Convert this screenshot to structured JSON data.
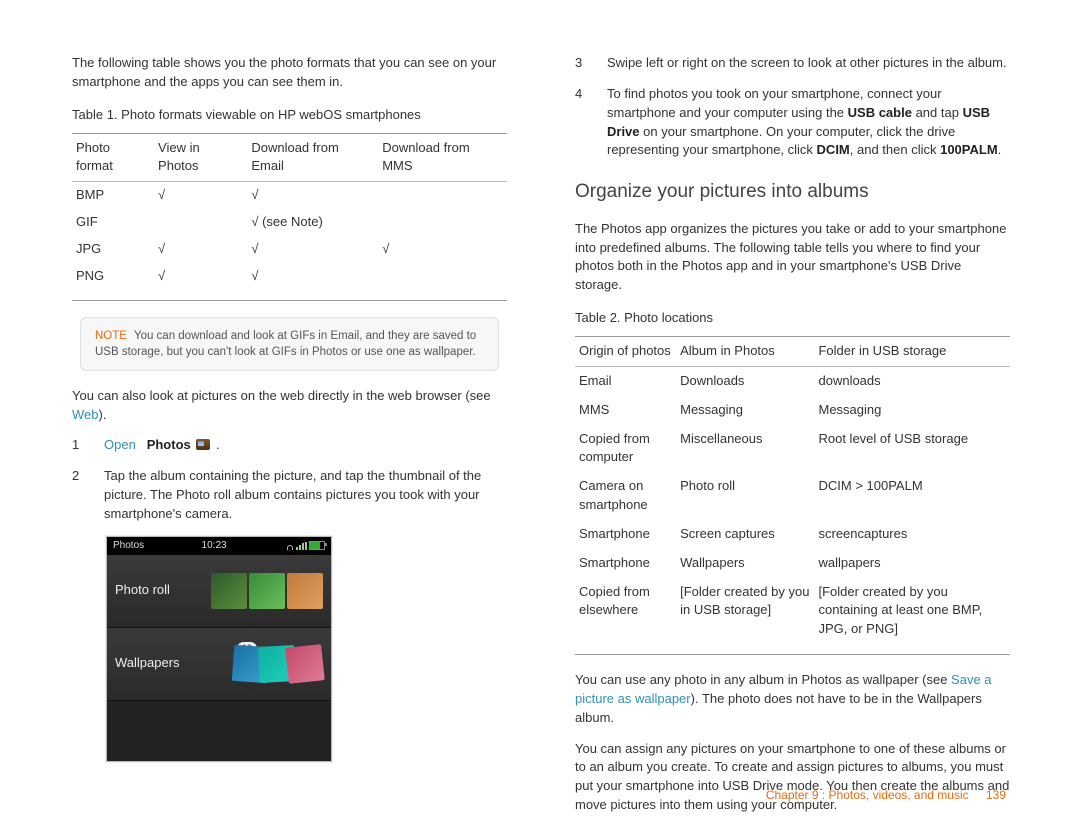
{
  "left": {
    "intro": "The following table shows you the photo formats that you can see on your smartphone and the apps you can see them in.",
    "table1_caption": "Table 1.  Photo formats viewable on HP webOS smartphones",
    "table1": {
      "headers": [
        "Photo format",
        "View in Photos",
        "Download from Email",
        "Download from MMS"
      ],
      "rows": [
        [
          "BMP",
          "√",
          "√",
          ""
        ],
        [
          "GIF",
          "",
          "√ (see Note)",
          ""
        ],
        [
          "JPG",
          "√",
          "√",
          "√"
        ],
        [
          "PNG",
          "√",
          "√",
          ""
        ]
      ]
    },
    "note_label": "NOTE",
    "note_text": "You can download and look at GIFs in Email, and they are saved to USB storage, but you can't look at GIFs in Photos or use one as wallpaper.",
    "web_para_pre": "You can also look at pictures on the web directly in the web browser (see ",
    "web_link": "Web",
    "web_para_post": ").",
    "steps12": {
      "s1_num": "1",
      "s1_open": "Open",
      "s1_photos": "Photos",
      "s1_period": ".",
      "s2_num": "2",
      "s2_text": "Tap the album containing the picture, and tap the thumbnail of the picture. The Photo roll album contains pictures you took with your smartphone's camera."
    },
    "phone": {
      "title": "Photos",
      "time": "10:23",
      "album1": "Photo roll",
      "album2": "Wallpapers",
      "badge": "13"
    }
  },
  "right": {
    "steps34": {
      "s3_num": "3",
      "s3_text": "Swipe left or right on the screen to look at other pictures in the album.",
      "s4_num": "4",
      "s4_pre": "To find photos you took on your smartphone, connect your smartphone and your computer using the ",
      "s4_b1": "USB cable",
      "s4_mid1": " and tap ",
      "s4_b2": "USB Drive",
      "s4_mid2": " on your smartphone. On your computer, click the drive representing your smartphone, click ",
      "s4_b3": "DCIM",
      "s4_mid3": ", and then click ",
      "s4_b4": "100PALM",
      "s4_post": "."
    },
    "h2": "Organize your pictures into albums",
    "org_intro": "The Photos app organizes the pictures you take or add to your smartphone into predefined albums. The following table tells you where to find your photos both in the Photos app and in your smartphone's USB Drive storage.",
    "table2_caption": "Table 2.  Photo locations",
    "table2": {
      "headers": [
        "Origin of photos",
        "Album in Photos",
        "Folder in USB storage"
      ],
      "rows": [
        [
          "Email",
          "Downloads",
          "downloads"
        ],
        [
          "MMS",
          "Messaging",
          "Messaging"
        ],
        [
          "Copied from computer",
          "Miscellaneous",
          "Root level of USB storage"
        ],
        [
          "Camera on smartphone",
          "Photo roll",
          "DCIM > 100PALM"
        ],
        [
          "Smartphone",
          "Screen captures",
          "screencaptures"
        ],
        [
          "Smartphone",
          "Wallpapers",
          "wallpapers"
        ],
        [
          "Copied from elsewhere",
          "[Folder created by you in USB storage]",
          "[Folder created by you containing at least one BMP, JPG, or PNG]"
        ]
      ]
    },
    "wall_para_pre": "You can use any photo in any album in Photos as wallpaper (see ",
    "wall_link": "Save a picture as wallpaper",
    "wall_para_post": "). The photo does not have to be in the Wallpapers album.",
    "assign_para": "You can assign any pictures on your smartphone to one of these albums or to an album you create. To create and assign pictures to albums, you must put your smartphone into USB Drive mode. You then create the albums and move pictures into them using your computer."
  },
  "footer": {
    "chapter": "Chapter 9 :  Photos, videos, and music",
    "page": "139"
  }
}
